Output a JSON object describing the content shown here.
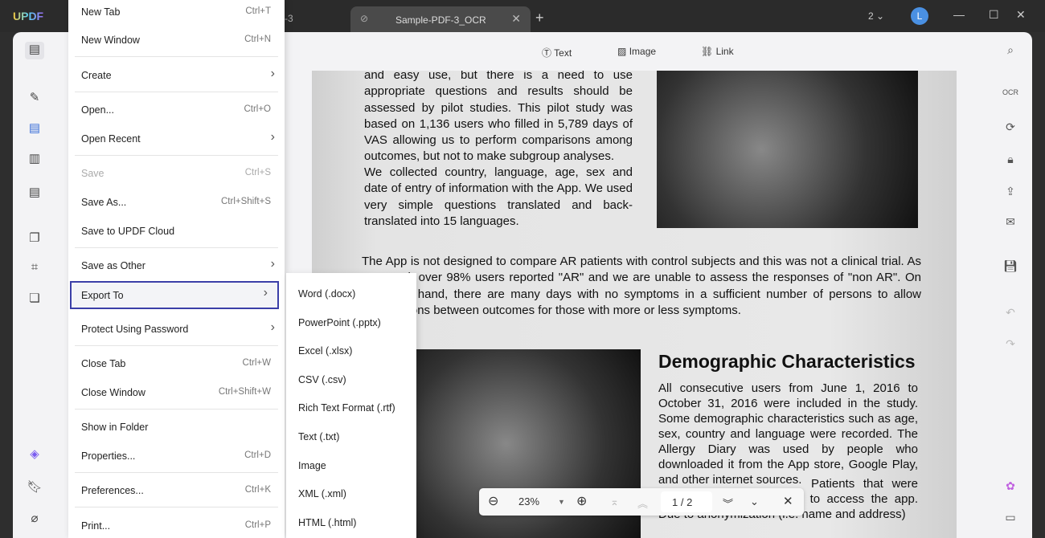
{
  "app": {
    "logo": "UPDF",
    "prev_tab_fragment": "-3",
    "tab_title": "Sample-PDF-3_OCR",
    "window_count": "2",
    "avatar_letter": "L"
  },
  "toolbar": {
    "text": "Text",
    "image": "Image",
    "link": "Link"
  },
  "menu": [
    {
      "label": "New Tab",
      "shortcut": "Ctrl+T"
    },
    {
      "label": "New Window",
      "shortcut": "Ctrl+N"
    },
    {
      "label": "Create",
      "submenu": true
    },
    {
      "label": "Open...",
      "shortcut": "Ctrl+O"
    },
    {
      "label": "Open Recent",
      "submenu": true
    },
    {
      "label": "Save",
      "shortcut": "Ctrl+S",
      "disabled": true
    },
    {
      "label": "Save As...",
      "shortcut": "Ctrl+Shift+S"
    },
    {
      "label": "Save to UPDF Cloud"
    },
    {
      "label": "Save as Other",
      "submenu": true
    },
    {
      "label": "Export To",
      "submenu": true,
      "highlighted": true
    },
    {
      "label": "Protect Using Password",
      "submenu": true
    },
    {
      "label": "Close Tab",
      "shortcut": "Ctrl+W"
    },
    {
      "label": "Close Window",
      "shortcut": "Ctrl+Shift+W"
    },
    {
      "label": "Show in Folder"
    },
    {
      "label": "Properties...",
      "shortcut": "Ctrl+D"
    },
    {
      "label": "Preferences...",
      "shortcut": "Ctrl+K"
    },
    {
      "label": "Print...",
      "shortcut": "Ctrl+P"
    }
  ],
  "export_submenu": [
    "Word (.docx)",
    "PowerPoint (.pptx)",
    "Excel (.xlsx)",
    "CSV (.csv)",
    "Rich Text Format (.rtf)",
    "Text (.txt)",
    "Image",
    "XML (.xml)",
    "HTML (.html)"
  ],
  "document": {
    "para1": "and easy use, but there is a need to use appropriate questions and results should be assessed by pilot studies. This pilot study was based on 1,136 users who filled in 5,789 days of VAS allowing us to perform comparisons among outcomes, but not to make subgroup analyses.",
    "para2": "We collected country, language, age, sex and date of entry of information with the App. We used very simple questions translated and back-translated into 15 languages.",
    "para3": "The App is not designed to compare AR patients with control subjects and this was not a clinical trial. As expected, over 98% users reported \"AR\" and we are unable to assess the responses of \"non AR\". On the other hand, there are many days with no symptoms in a sufficient number of persons to allow comparisons between outcomes for those with more or less symptoms.",
    "heading": "Demographic Characteristics",
    "para4": "All consecutive users from June 1, 2016 to October 31, 2016 were included in the study. Some demographic characteristics such as age, sex, country and language were recorded. The Allergy Diary was used by people who downloaded it from the App store, Google Play, and other internet sources.",
    "para5": "Patients that were asked by their physicians to access the app. Due to anonymization (i.e. name and address)"
  },
  "zoombar": {
    "zoom": "23%",
    "page": "1 / 2"
  }
}
